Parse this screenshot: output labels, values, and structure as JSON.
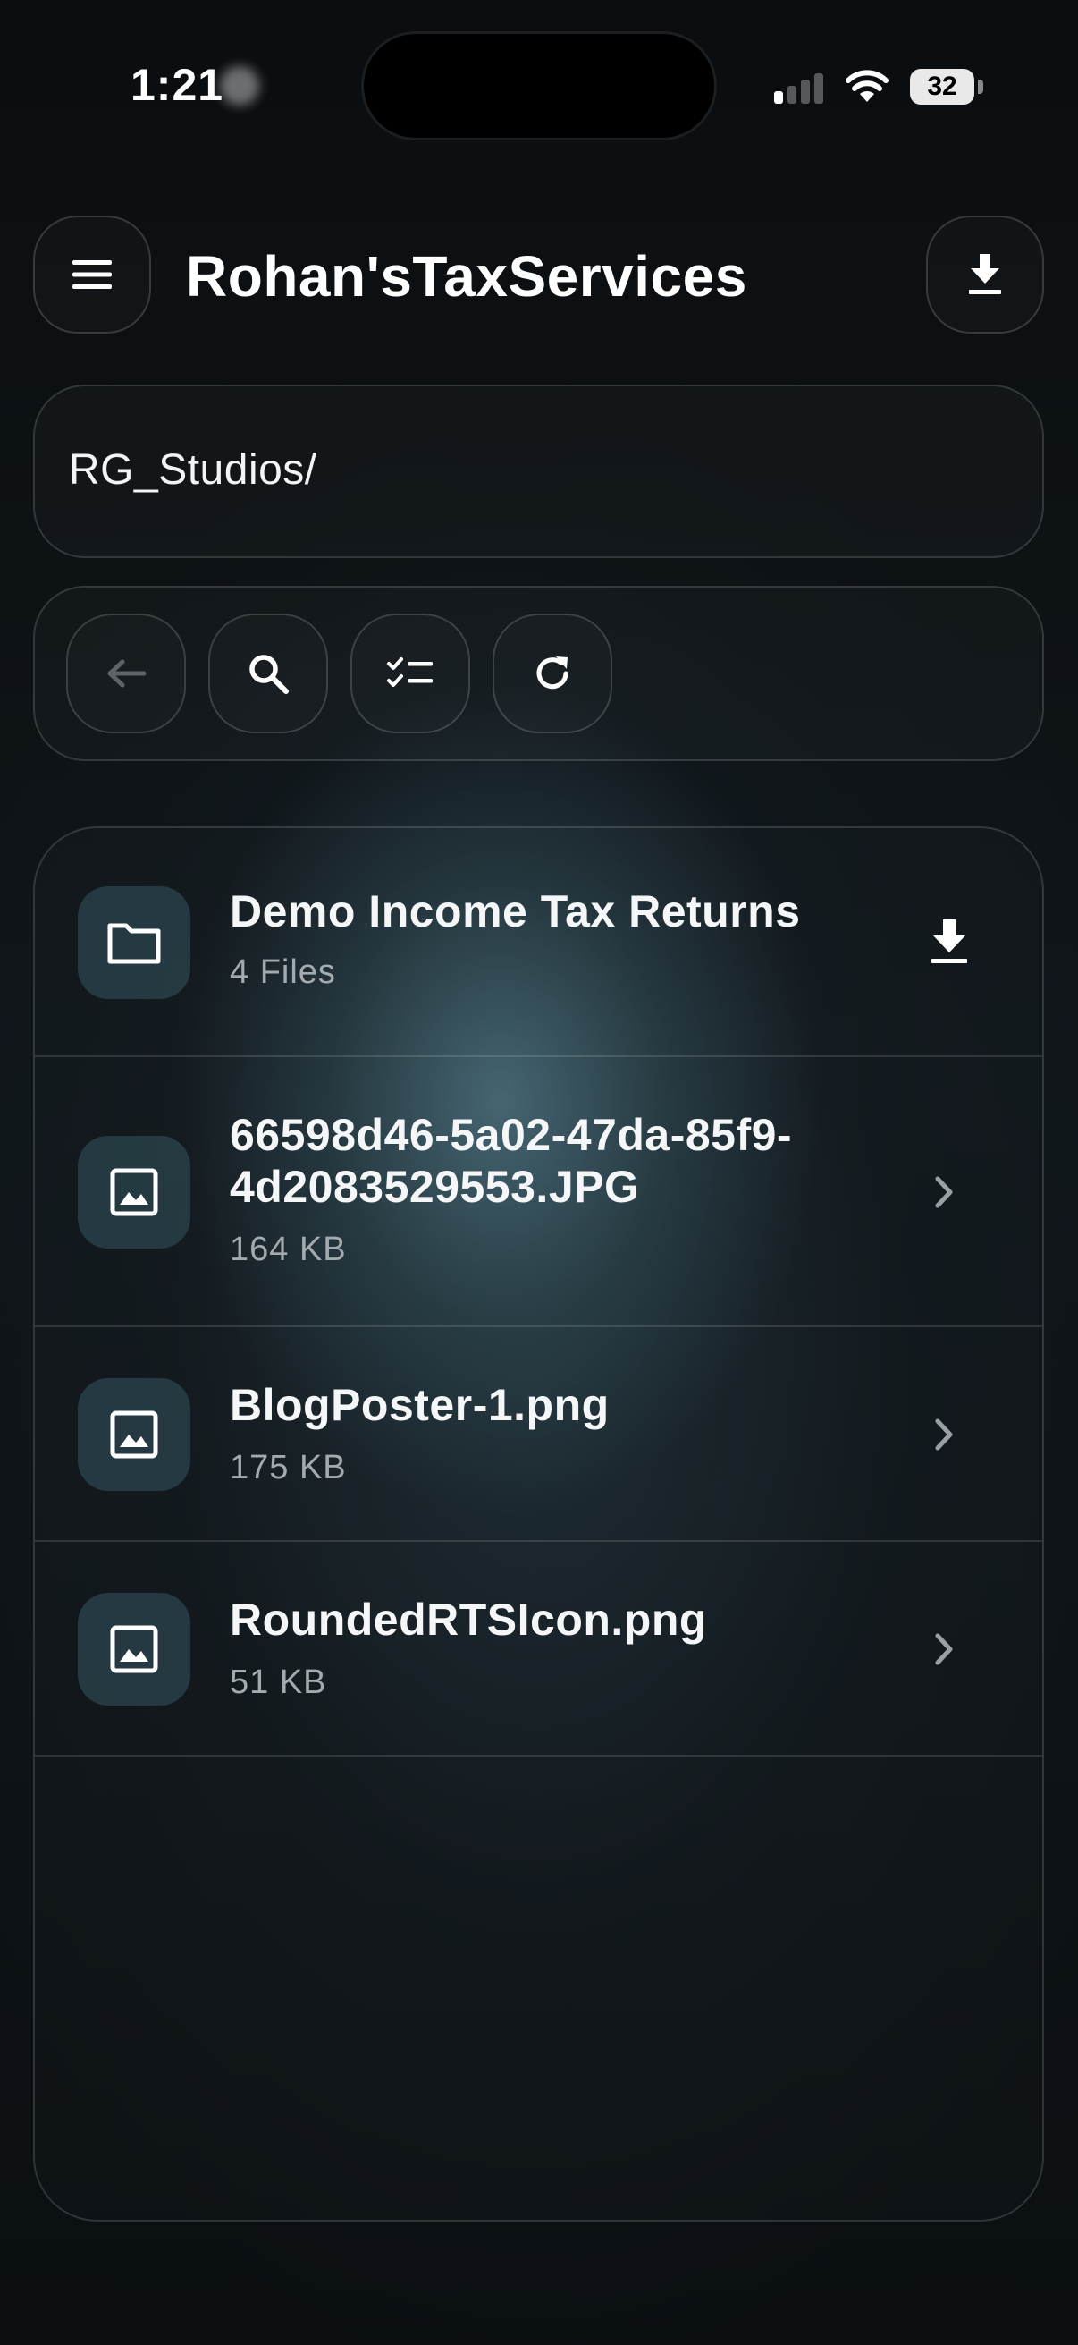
{
  "status_bar": {
    "time": "1:21",
    "battery": "32"
  },
  "header": {
    "title": "Rohan'sTaxServices",
    "menu_icon": "hamburger-menu-icon",
    "download_icon": "download-icon"
  },
  "path_bar": {
    "path": "RG_Studios/"
  },
  "toolbar": {
    "buttons": [
      {
        "icon": "back-arrow-icon",
        "enabled": false
      },
      {
        "icon": "search-icon",
        "enabled": true
      },
      {
        "icon": "checklist-select-icon",
        "enabled": true
      },
      {
        "icon": "refresh-icon",
        "enabled": true
      }
    ]
  },
  "files": [
    {
      "type": "folder",
      "icon": "folder-icon",
      "name": "Demo Income Tax Returns",
      "meta": "4 Files",
      "action_icon": "download-icon"
    },
    {
      "type": "image",
      "icon": "image-icon",
      "name": "66598d46-5a02-47da-85f9-4d2083529553.JPG",
      "meta": "164 KB",
      "action_icon": "chevron-right-icon"
    },
    {
      "type": "image",
      "icon": "image-icon",
      "name": "BlogPoster-1.png",
      "meta": "175 KB",
      "action_icon": "chevron-right-icon"
    },
    {
      "type": "image",
      "icon": "image-icon",
      "name": "RoundedRTSIcon.png",
      "meta": "51 KB",
      "action_icon": "chevron-right-icon"
    }
  ]
}
